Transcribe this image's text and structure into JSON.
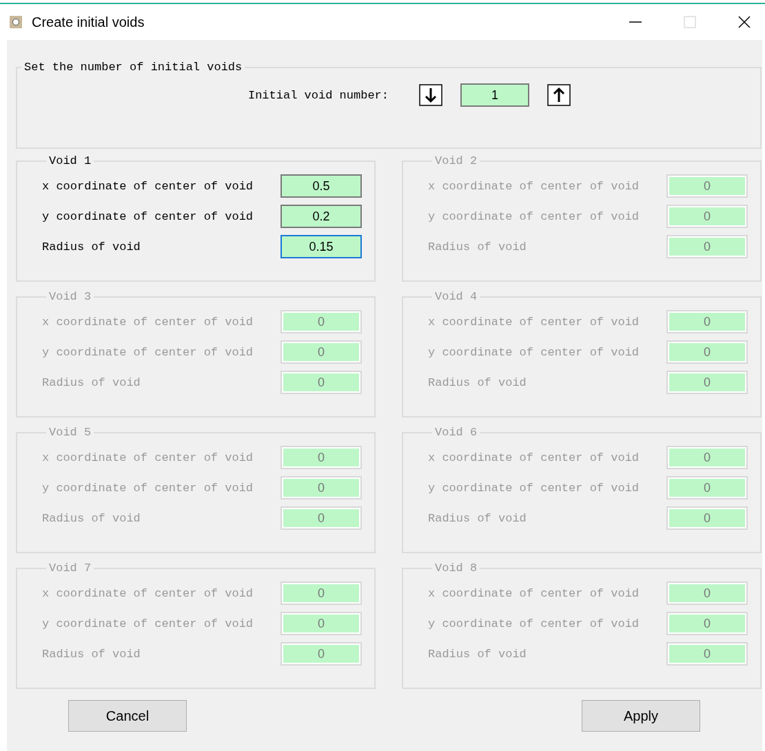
{
  "window": {
    "title": "Create initial voids"
  },
  "count_group": {
    "title": "Set the number of initial voids",
    "label": "Initial void number:",
    "value": "1"
  },
  "voids": [
    {
      "title": "Void 1",
      "disabled": false,
      "fields": [
        {
          "label": "x coordinate of center of void",
          "value": "0.5",
          "focused": false
        },
        {
          "label": "y coordinate of center of void",
          "value": "0.2",
          "focused": false
        },
        {
          "label": "Radius of void",
          "value": "0.15",
          "focused": true
        }
      ]
    },
    {
      "title": "Void 2",
      "disabled": true,
      "fields": [
        {
          "label": "x coordinate of center of void",
          "value": "0",
          "focused": false
        },
        {
          "label": "y coordinate of center of void",
          "value": "0",
          "focused": false
        },
        {
          "label": "Radius of void",
          "value": "0",
          "focused": false
        }
      ]
    },
    {
      "title": "Void 3",
      "disabled": true,
      "fields": [
        {
          "label": "x coordinate of center of void",
          "value": "0",
          "focused": false
        },
        {
          "label": "y coordinate of center of void",
          "value": "0",
          "focused": false
        },
        {
          "label": "Radius of void",
          "value": "0",
          "focused": false
        }
      ]
    },
    {
      "title": "Void 4",
      "disabled": true,
      "fields": [
        {
          "label": "x coordinate of center of void",
          "value": "0",
          "focused": false
        },
        {
          "label": "y coordinate of center of void",
          "value": "0",
          "focused": false
        },
        {
          "label": "Radius of void",
          "value": "0",
          "focused": false
        }
      ]
    },
    {
      "title": "Void 5",
      "disabled": true,
      "fields": [
        {
          "label": "x coordinate of center of void",
          "value": "0",
          "focused": false
        },
        {
          "label": "y coordinate of center of void",
          "value": "0",
          "focused": false
        },
        {
          "label": "Radius of void",
          "value": "0",
          "focused": false
        }
      ]
    },
    {
      "title": "Void 6",
      "disabled": true,
      "fields": [
        {
          "label": "x coordinate of center of void",
          "value": "0",
          "focused": false
        },
        {
          "label": "y coordinate of center of void",
          "value": "0",
          "focused": false
        },
        {
          "label": "Radius of void",
          "value": "0",
          "focused": false
        }
      ]
    },
    {
      "title": "Void 7",
      "disabled": true,
      "fields": [
        {
          "label": "x coordinate of center of void",
          "value": "0",
          "focused": false
        },
        {
          "label": "y coordinate of center of void",
          "value": "0",
          "focused": false
        },
        {
          "label": "Radius of void",
          "value": "0",
          "focused": false
        }
      ]
    },
    {
      "title": "Void 8",
      "disabled": true,
      "fields": [
        {
          "label": "x coordinate of center of void",
          "value": "0",
          "focused": false
        },
        {
          "label": "y coordinate of center of void",
          "value": "0",
          "focused": false
        },
        {
          "label": "Radius of void",
          "value": "0",
          "focused": false
        }
      ]
    }
  ],
  "buttons": [
    {
      "label": "Cancel"
    },
    {
      "label": "Apply"
    }
  ]
}
